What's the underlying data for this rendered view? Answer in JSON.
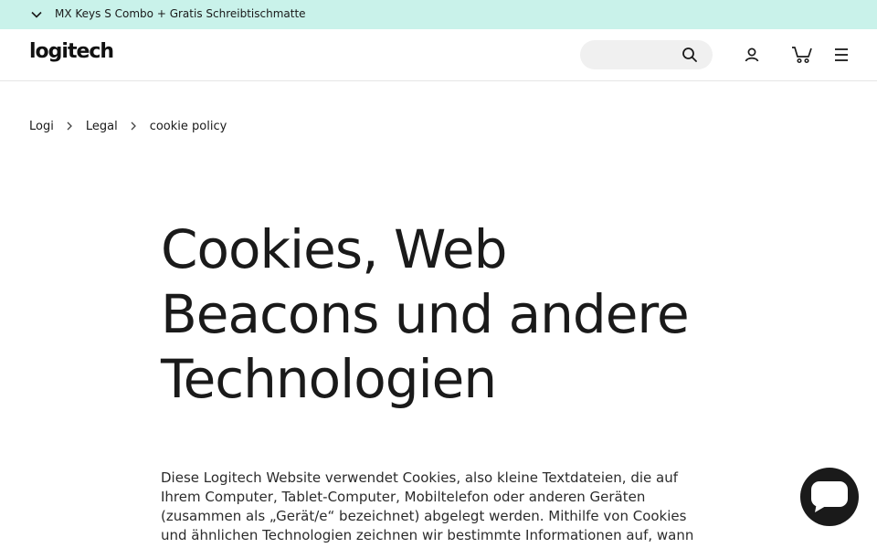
{
  "promo": {
    "text": "MX Keys S Combo + Gratis Schreibtischmatte",
    "chevron_icon": "chevron-down-icon",
    "background": "#c9f2ea"
  },
  "header": {
    "logo": "logitech",
    "search": {
      "placeholder": "",
      "icon": "search-icon"
    },
    "icons": [
      "user-icon",
      "cart-icon",
      "menu-icon"
    ]
  },
  "breadcrumb": {
    "items": [
      "Logi",
      "Legal",
      "cookie policy"
    ]
  },
  "main": {
    "title": "Cookies, Web Beacons und andere Technologien",
    "body": "Diese Logitech Website verwendet Cookies, also kleine Textdateien, die auf Ihrem Computer, Tablet-Computer, Mobiltelefon oder anderen Geräten (zusammen als „Gerät/e“ bezeichnet) abgelegt werden. Mithilfe von Cookies und ähnlichen Technologien zeichnen wir bestimmte Informationen auf, wann immer Sie unsere"
  },
  "chat": {
    "icon": "chat-icon",
    "color": "#1a1a1a"
  }
}
